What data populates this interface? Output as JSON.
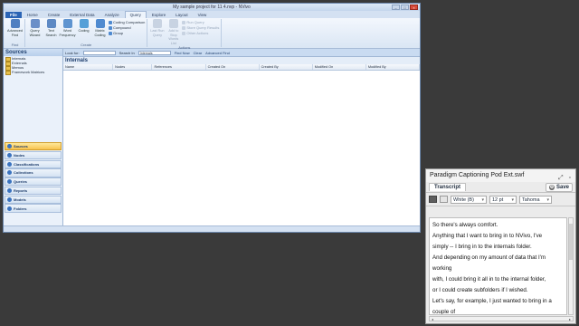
{
  "nvivo": {
    "title": "My sample project for 11 4.nvp - NVivo",
    "tabs": [
      "File",
      "Home",
      "Create",
      "External Data",
      "Analyze",
      "Query",
      "Explore",
      "Layout",
      "View"
    ],
    "active_tab": "Query",
    "ribbon": {
      "groups": [
        {
          "label": "Find",
          "buttons": [
            {
              "label": "Advanced Find",
              "icon": "binoculars-icon",
              "color": "#4f7fc1"
            }
          ]
        },
        {
          "label": "Create",
          "buttons": [
            {
              "label": "Query Wizard",
              "icon": "wizard-icon",
              "color": "#6b8fc8"
            },
            {
              "label": "Text Search",
              "icon": "text-search-icon",
              "color": "#5d89c4"
            },
            {
              "label": "Word Frequency",
              "icon": "word-frequency-icon",
              "color": "#5f94d0"
            },
            {
              "label": "Coding",
              "icon": "coding-icon",
              "color": "#55a0d8"
            },
            {
              "label": "Matrix Coding",
              "icon": "matrix-icon",
              "color": "#4f8ad0"
            }
          ],
          "small": [
            "Coding Comparison",
            "Compound",
            "Group"
          ]
        },
        {
          "label": "Actions",
          "buttons": [
            {
              "label": "Last Run Query",
              "icon": "last-query-icon",
              "color": "#c8d3e2"
            },
            {
              "label": "Add to Stop Words List",
              "icon": "stop-words-icon",
              "color": "#c8d3e2"
            }
          ],
          "small": [
            "Run Query",
            "Store Query Results",
            "Other Actions"
          ]
        }
      ]
    },
    "nav": {
      "header": "Sources",
      "tree": [
        "Internals",
        "Externals",
        "Memos",
        "Framework Matrices"
      ],
      "sections": [
        {
          "label": "Sources",
          "active": true
        },
        {
          "label": "Nodes",
          "active": false
        },
        {
          "label": "Classifications",
          "active": false
        },
        {
          "label": "Collections",
          "active": false
        },
        {
          "label": "Queries",
          "active": false
        },
        {
          "label": "Reports",
          "active": false
        },
        {
          "label": "Models",
          "active": false
        },
        {
          "label": "Folders",
          "active": false
        }
      ],
      "footer": "NPE  ▸ Sources"
    },
    "findbar": {
      "look_for_label": "Look for:",
      "look_for_value": "",
      "search_in_label": "Search In",
      "search_in_value": "Internals",
      "find_now": "Find Now",
      "clear": "Clear",
      "advanced_find": "Advanced Find"
    },
    "list": {
      "title": "Internals",
      "columns": [
        "Name",
        "Nodes",
        "References",
        "Created On",
        "Created By",
        "Modified On",
        "Modified By"
      ]
    }
  },
  "captioning": {
    "title": "Paradigm Captioning Pod Ext.swf",
    "tab": "Transcript",
    "save_label": "Save",
    "color_value": "White (B)",
    "size_value": "12 pt",
    "font_value": "Tahoma",
    "lines": [
      "So there's always comfort.",
      "Anything that I want to bring in to NVivo, I've",
      "simply -- I bring in to the internals folder.",
      "And depending on my amount of data that I'm",
      "working",
      "with, I could bring it all in to the internal folder,",
      "or I could create subfolders if I wished.",
      "Let's say, for example, I just wanted to bring in a",
      "couple of"
    ]
  }
}
